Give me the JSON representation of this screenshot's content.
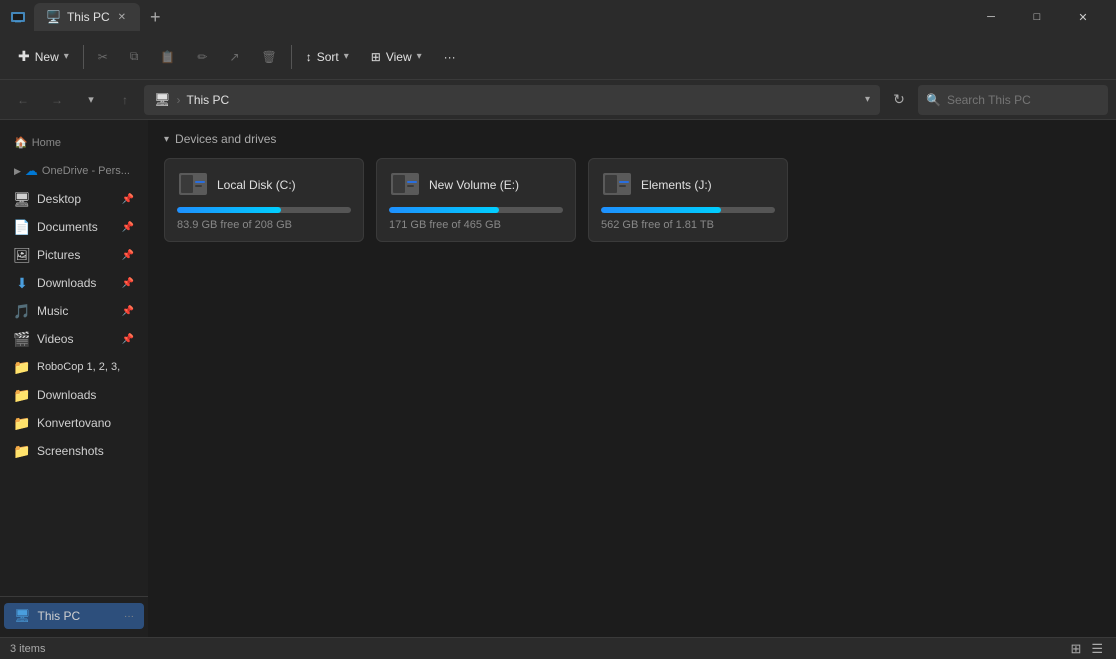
{
  "titlebar": {
    "tab_label": "This PC",
    "tab_icon": "🖥️",
    "btn_minimize": "─",
    "btn_maximize": "□",
    "btn_close": "✕",
    "btn_new_tab": "+"
  },
  "toolbar": {
    "new_label": "New",
    "cut_icon": "✂",
    "copy_icon": "⧉",
    "paste_icon": "📋",
    "rename_icon": "✏",
    "share_icon": "↗",
    "delete_icon": "🗑",
    "sort_label": "Sort",
    "view_label": "View",
    "more_icon": "···"
  },
  "navbar": {
    "back_icon": "←",
    "forward_icon": "→",
    "up_icon": "↑",
    "recent_icon": "🕐",
    "path_icon": "🖥",
    "path_label": "This PC",
    "refresh_icon": "↻",
    "search_placeholder": "Search This PC"
  },
  "sidebar": {
    "onedrive_label": "OneDrive - Pers...",
    "items": [
      {
        "id": "desktop",
        "label": "Desktop",
        "icon": "🖥",
        "pinned": true
      },
      {
        "id": "documents",
        "label": "Documents",
        "icon": "📄",
        "pinned": true
      },
      {
        "id": "pictures",
        "label": "Pictures",
        "icon": "🖼",
        "pinned": true
      },
      {
        "id": "downloads",
        "label": "Downloads",
        "icon": "⬇",
        "pinned": true
      },
      {
        "id": "music",
        "label": "Music",
        "icon": "🎵",
        "pinned": true
      },
      {
        "id": "videos",
        "label": "Videos",
        "icon": "🎬",
        "pinned": true
      },
      {
        "id": "robocop",
        "label": "RoboCop 1, 2, 3,",
        "icon": "📁",
        "pinned": false
      },
      {
        "id": "downloads2",
        "label": "Downloads",
        "icon": "📁",
        "pinned": false
      },
      {
        "id": "konvertovano",
        "label": "Konvertovano",
        "icon": "📁",
        "pinned": false
      },
      {
        "id": "screenshots",
        "label": "Screenshots",
        "icon": "📁",
        "pinned": false
      }
    ],
    "this_pc_label": "This PC",
    "dots": "···"
  },
  "content": {
    "section_label": "Devices and drives",
    "drives": [
      {
        "id": "c",
        "name": "Local Disk (C:)",
        "free_gb": 83.9,
        "total_gb": 208,
        "free_label": "83.9 GB free of 208 GB",
        "fill_pct": 60,
        "warning": false
      },
      {
        "id": "e",
        "name": "New Volume (E:)",
        "free_gb": 171,
        "total_gb": 465,
        "free_label": "171 GB free of 465 GB",
        "fill_pct": 63,
        "warning": false
      },
      {
        "id": "j",
        "name": "Elements (J:)",
        "free_gb": 562,
        "total_gb": 1810,
        "free_label": "562 GB free of 1.81 TB",
        "fill_pct": 69,
        "warning": false
      }
    ]
  },
  "statusbar": {
    "count_label": "3 items",
    "separator": "|"
  }
}
